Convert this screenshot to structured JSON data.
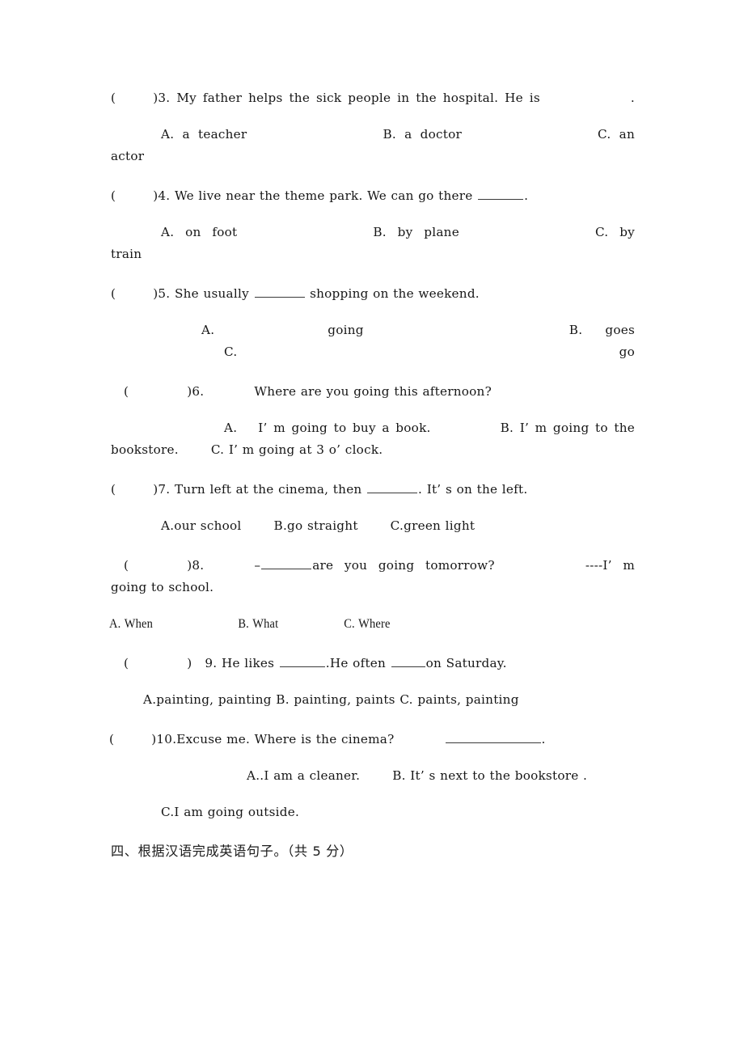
{
  "document": {
    "type": "exam-worksheet",
    "language": "English with Chinese section heading",
    "page_background": "#ffffff",
    "text_color": "#161616"
  },
  "questions": [
    {
      "id": "q3",
      "marker_open": "(",
      "marker_close": ")",
      "number": "3.",
      "stem": "My father helps the sick people in the hospital. He is",
      "stem_tail": ".",
      "options": [
        {
          "letter": "A.",
          "text": "a teacher"
        },
        {
          "letter": "B.",
          "text": "a doctor"
        },
        {
          "letter": "C.",
          "text": "an actor"
        }
      ]
    },
    {
      "id": "q4",
      "marker_open": "(",
      "marker_close": ")",
      "number": "4.",
      "stem": "We live near the theme park. We can go there",
      "stem_tail": ".",
      "options": [
        {
          "letter": "A.",
          "text": "on foot"
        },
        {
          "letter": "B.",
          "text": "by plane"
        },
        {
          "letter": "C.",
          "text": "by train"
        }
      ]
    },
    {
      "id": "q5",
      "marker_open": "(",
      "marker_close": ")",
      "number": "5.",
      "stem_before": "She usually",
      "stem_after": "shopping on the weekend.",
      "options": [
        {
          "letter": "A.",
          "text": "going"
        },
        {
          "letter": "B.",
          "text": "goes"
        },
        {
          "letter": "C.",
          "text": "go"
        }
      ]
    },
    {
      "id": "q6",
      "marker_open": "(",
      "marker_close": ")",
      "number": "6.",
      "stem": "Where are you going this afternoon?",
      "options": [
        {
          "letter": "A.",
          "text": "I’ m going to buy a book."
        },
        {
          "letter": "B.",
          "text": "I’ m going to the bookstore."
        },
        {
          "letter": "C.",
          "text": "I’ m going at 3 o’ clock."
        }
      ]
    },
    {
      "id": "q7",
      "marker_open": "(",
      "marker_close": ")",
      "number": "7.",
      "stem_before": "Turn left at the cinema, then",
      "stem_after": ". It’ s on the left.",
      "options": [
        {
          "letter": "A.",
          "text": "our school"
        },
        {
          "letter": "B.",
          "text": "go straight"
        },
        {
          "letter": "C.",
          "text": "green light"
        }
      ]
    },
    {
      "id": "q8",
      "marker_open": "(",
      "marker_close": ")",
      "number": "8.",
      "dash": "–",
      "stem_after": "are you going tomorrow?",
      "answer_dashes": "----",
      "answer_text": "I’ m going to school.",
      "options": [
        {
          "letter": "A.",
          "text": "When"
        },
        {
          "letter": "B.",
          "text": "What"
        },
        {
          "letter": "C.",
          "text": "Where"
        }
      ]
    },
    {
      "id": "q9",
      "marker_open": "(",
      "marker_close": ")",
      "number": "9.",
      "stem_a": "He likes",
      "stem_b": ".He often",
      "stem_c": "on Saturday.",
      "options": [
        {
          "letter": "A.",
          "text": "painting, painting"
        },
        {
          "letter": "B.",
          "text": "painting, paints"
        },
        {
          "letter": "C.",
          "text": "paints, painting"
        }
      ]
    },
    {
      "id": "q10",
      "marker_open": "(",
      "marker_close": ")",
      "number": "10.",
      "stem": "Excuse me. Where is the cinema?",
      "stem_tail": ".",
      "options": [
        {
          "letter": "A..",
          "text": "I am a cleaner."
        },
        {
          "letter": "B.",
          "text": "It’ s next to the bookstore ."
        },
        {
          "letter": "C.",
          "text": "I  am going outside."
        }
      ]
    }
  ],
  "section_heading": {
    "text": "四、根据汉语完成英语句子。（共 5 分）"
  }
}
